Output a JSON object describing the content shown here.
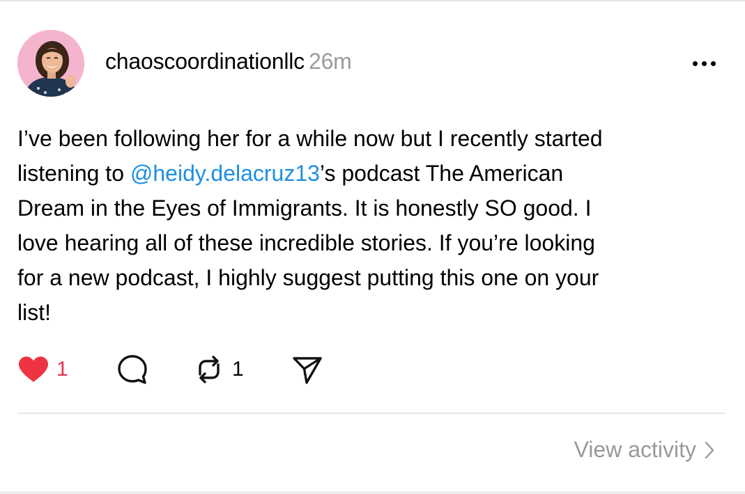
{
  "post": {
    "author": {
      "username": "chaoscoordinationllc",
      "avatar": "profile-photo"
    },
    "timestamp": "26m",
    "text": {
      "line1": "I’ve been following her for a while now but I recently started",
      "line2_before": "listening to ",
      "mention": "@heidy.delacruz13",
      "line2_after": "’s podcast The American",
      "line3": "Dream in the Eyes of Immigrants. It is honestly SO good. I",
      "line4": "love hearing all of these incredible stories. If you’re looking",
      "line5": "for a new podcast, I highly suggest putting this one on your",
      "line6": "list!"
    },
    "actions": {
      "like_count": "1",
      "liked": true,
      "repost_count": "1",
      "icons": [
        "heart-icon",
        "comment-icon",
        "repost-icon",
        "share-icon"
      ]
    }
  },
  "footer": {
    "view_activity_label": "View activity"
  },
  "colors": {
    "mention": "#1d8fe1",
    "like": "#e8334a",
    "muted": "#999999"
  }
}
